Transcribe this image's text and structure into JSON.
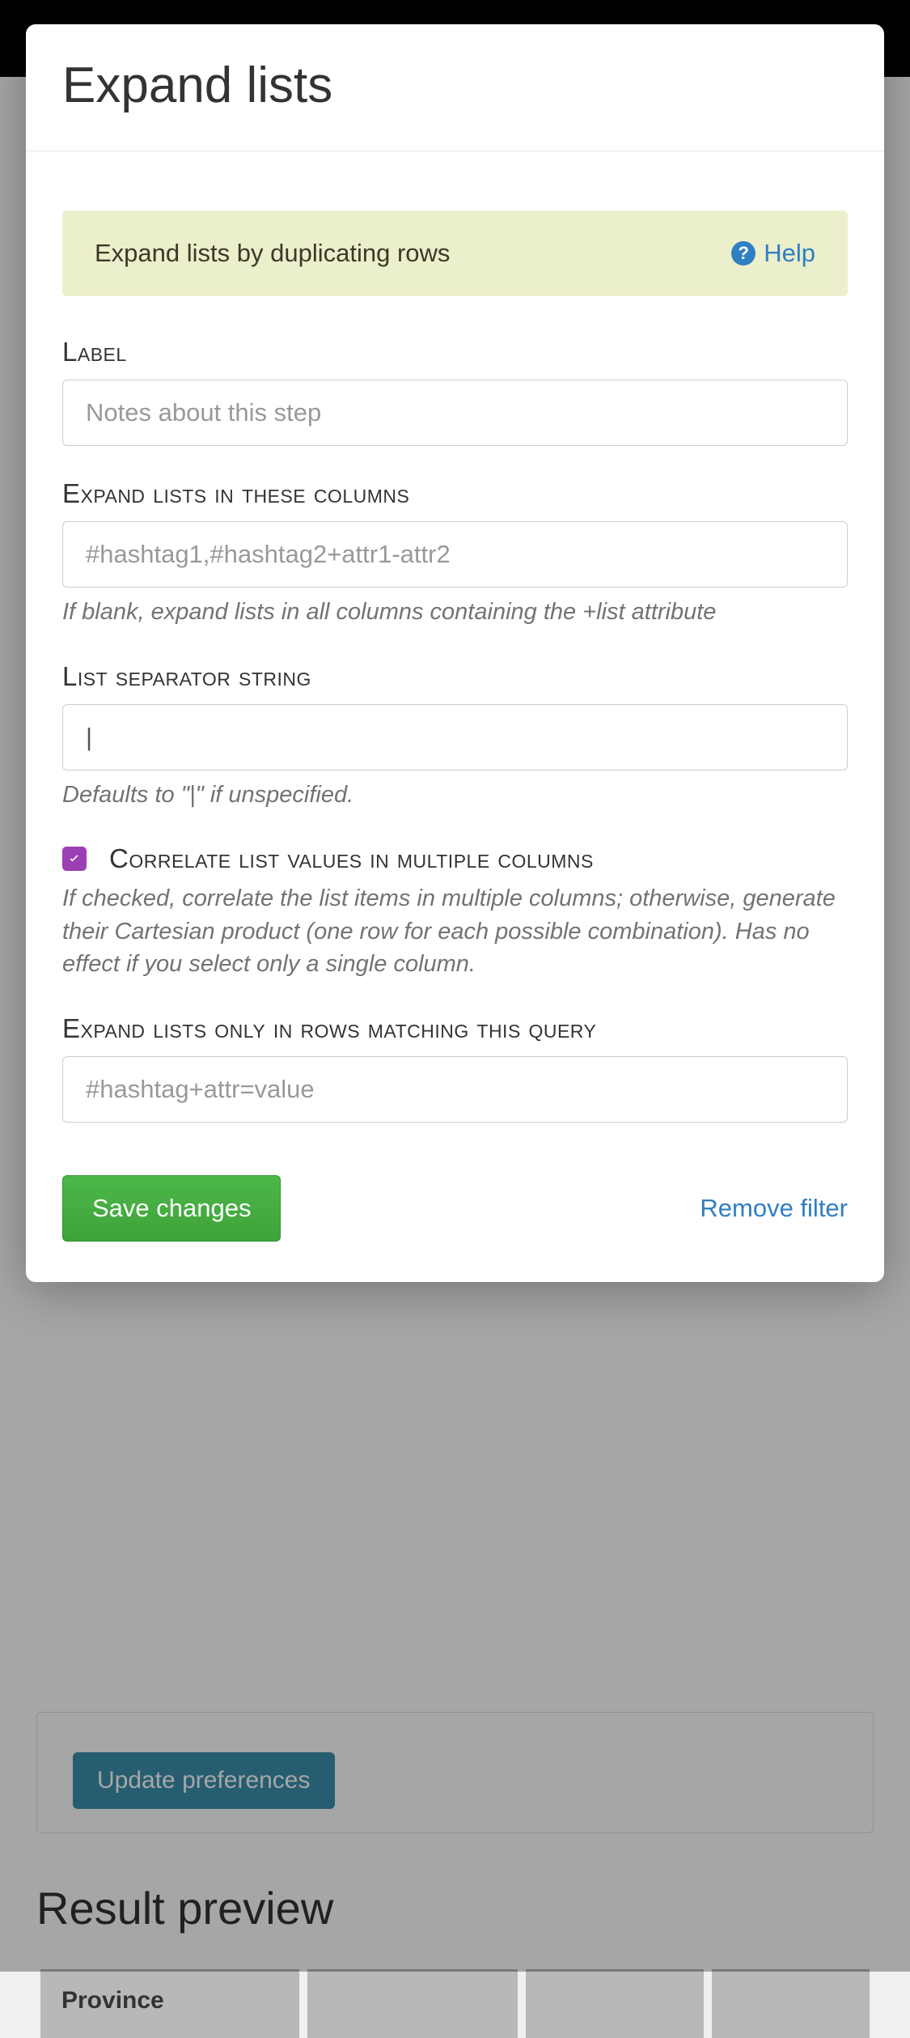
{
  "modal": {
    "title": "Expand lists",
    "alert_text": "Expand lists by duplicating rows",
    "help_label": "Help",
    "labels": {
      "label": "Label",
      "columns": "Expand lists in these columns",
      "separator": "List separator string",
      "correlate": "Correlate list values in multiple columns",
      "query": "Expand lists only in rows matching this query"
    },
    "placeholders": {
      "label": "Notes about this step",
      "columns": "#hashtag1,#hashtag2+attr1-attr2",
      "query": "#hashtag+attr=value"
    },
    "values": {
      "separator": "|"
    },
    "help_texts": {
      "columns": "If blank, expand lists in all columns containing the +list attribute",
      "separator": "Defaults to \"|\" if unspecified.",
      "correlate": "If checked, correlate the list items in multiple columns; otherwise, generate their Cartesian product (one row for each possible combination). Has no effect if you select only a single column."
    },
    "correlate_checked": true,
    "save_label": "Save changes",
    "remove_label": "Remove filter"
  },
  "background": {
    "update_button": "Update preferences",
    "result_heading": "Result preview",
    "table_headers": [
      "Province",
      "",
      "",
      ""
    ],
    "partial_link": "lc"
  }
}
